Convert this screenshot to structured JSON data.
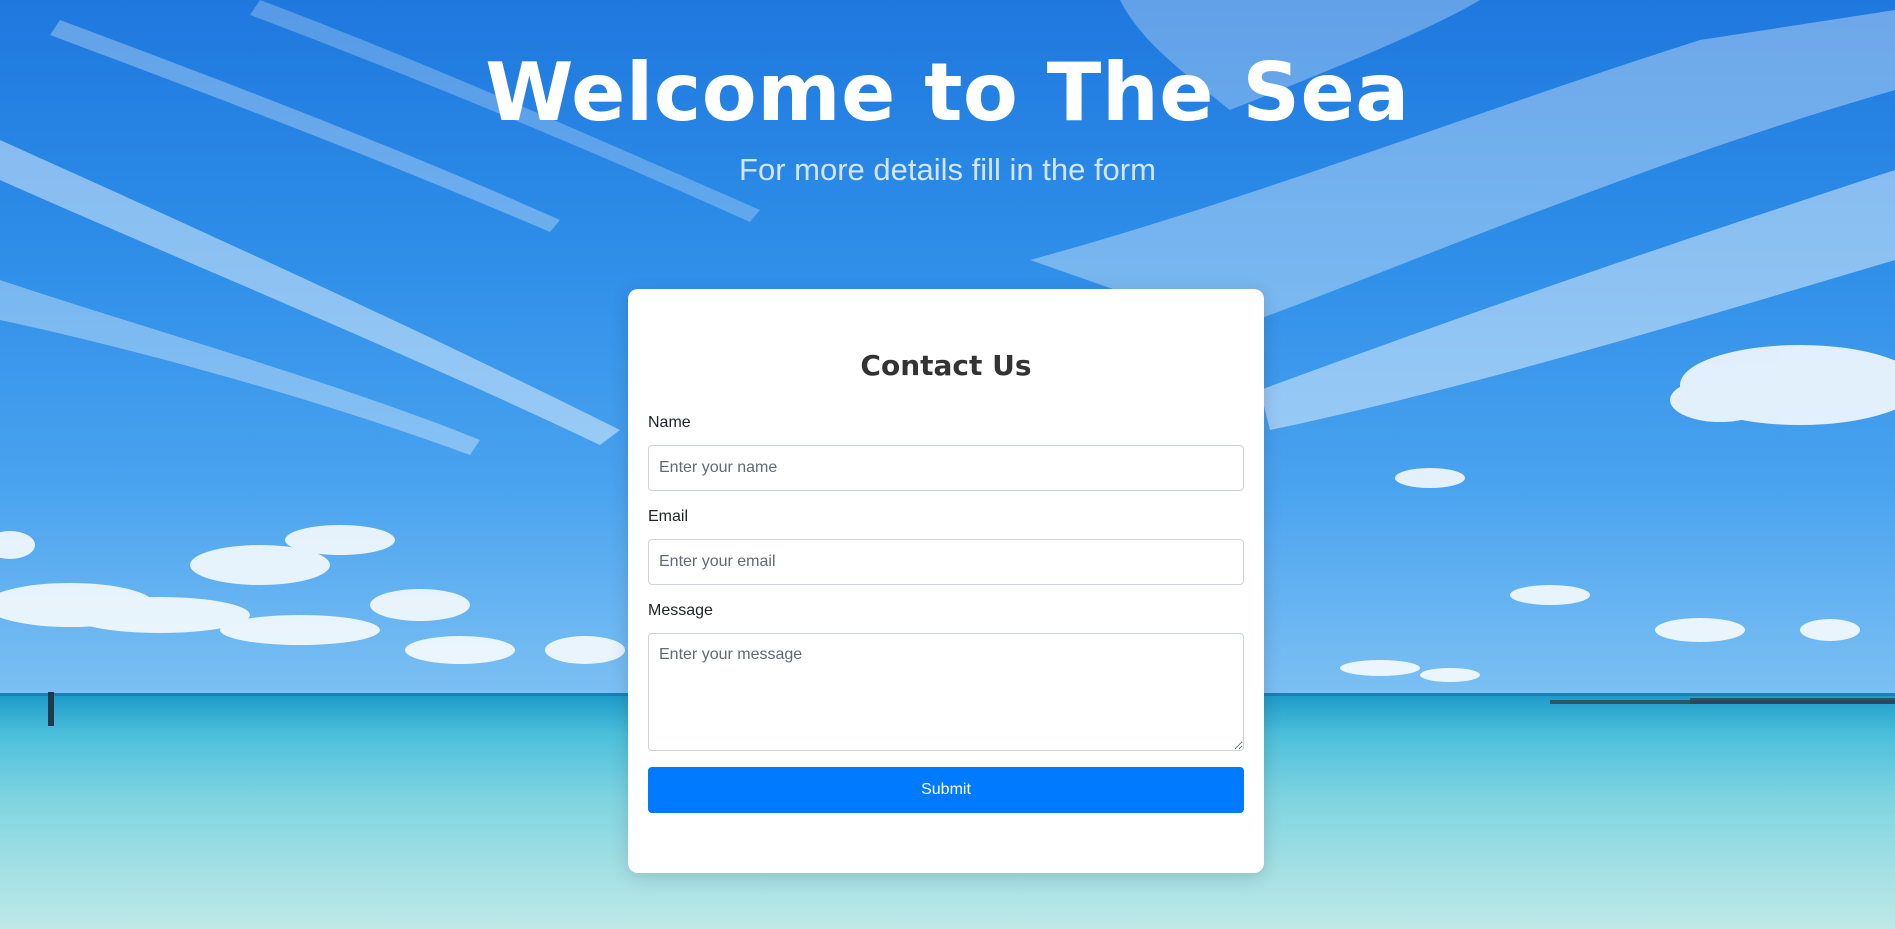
{
  "hero": {
    "title": "Welcome to The Sea",
    "subtitle": "For more details fill in the form"
  },
  "form": {
    "title": "Contact Us",
    "name_label": "Name",
    "name_placeholder": "Enter your name",
    "email_label": "Email",
    "email_placeholder": "Enter your email",
    "message_label": "Message",
    "message_placeholder": "Enter your message",
    "submit_label": "Submit"
  },
  "colors": {
    "accent": "#007bff",
    "card_bg": "#ffffff",
    "title_text": "#333333"
  }
}
